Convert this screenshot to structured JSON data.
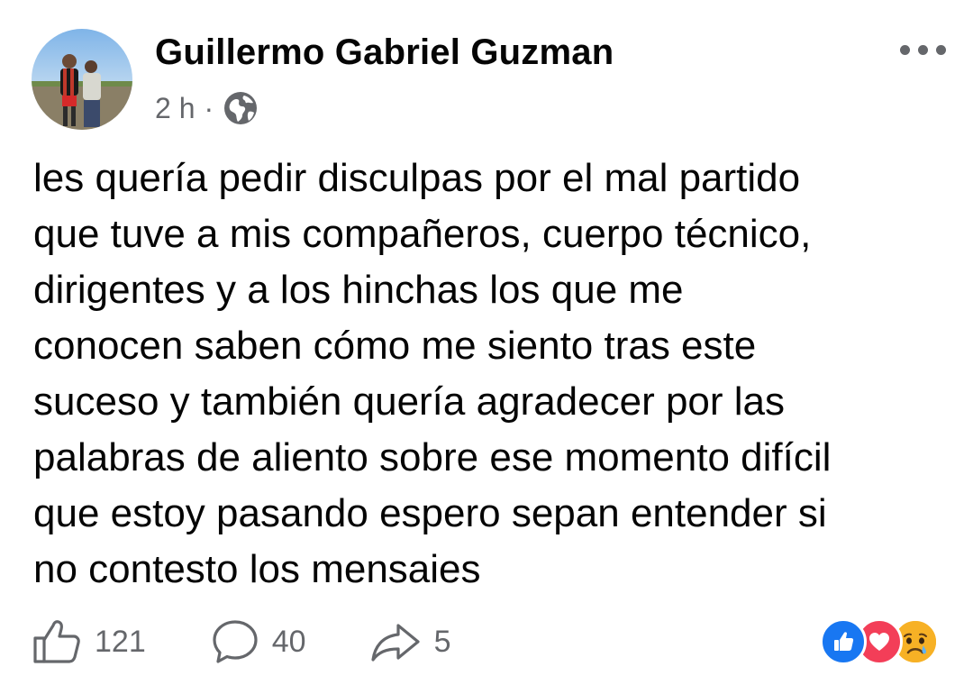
{
  "author": {
    "name": "Guillermo Gabriel Guzman",
    "time": "2 h",
    "separator": "·",
    "audience_icon": "globe-icon",
    "avatar_icon": "profile-photo"
  },
  "menu_icon": "more-horizontal-icon",
  "post": {
    "text": "les quería pedir disculpas por el mal partido\nque tuve a mis compañeros, cuerpo técnico,\ndirigentes y a los hinchas los que me\nconocen saben cómo me siento tras este\nsuceso y también quería agradecer por las\npalabras de aliento sobre ese momento difícil\nque estoy pasando espero sepan entender si\nno contesto los mensaies"
  },
  "actions": {
    "likes": "121",
    "comments": "40",
    "shares": "5"
  },
  "reactions": [
    "like",
    "love",
    "sad"
  ],
  "colors": {
    "text": "#050505",
    "secondary": "#65676b",
    "like_blue": "#1877f2",
    "love_red": "#f33e58",
    "sad_yellow": "#f7b125"
  }
}
